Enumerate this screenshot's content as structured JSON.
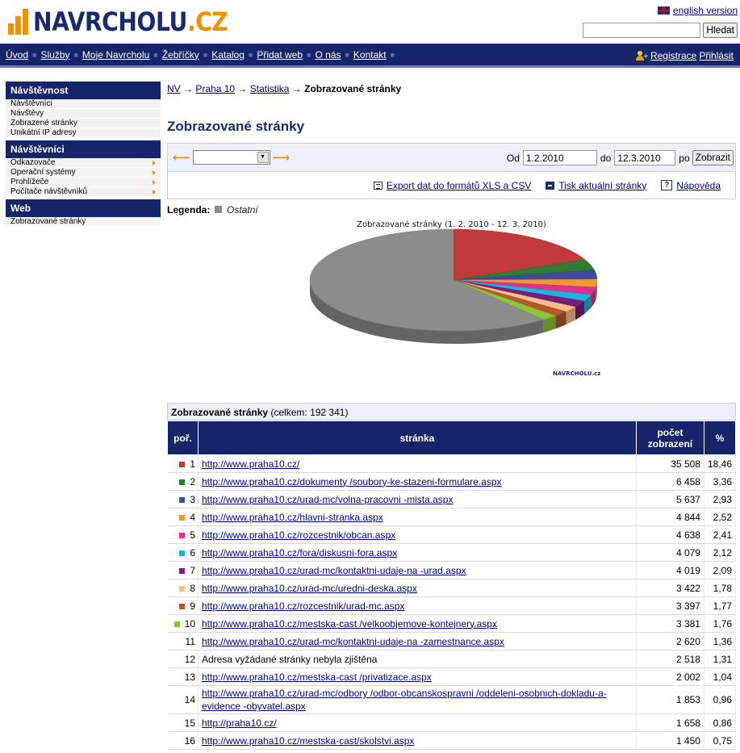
{
  "header": {
    "logo_main": "NAVRCHOLU",
    "logo_tld": ".CZ",
    "lang_link": "english version",
    "search_placeholder": "",
    "search_button": "Hledat"
  },
  "nav": {
    "items": [
      "Úvod",
      "Služby",
      "Moje Navrcholu",
      "Žebříčky",
      "Katalog",
      "Přidat web",
      "O nás",
      "Kontakt"
    ],
    "register": "Registrace",
    "login": "Přihlásit"
  },
  "sidebar": {
    "sections": [
      {
        "title": "Návštěvnost",
        "items": [
          {
            "label": "Návštěvníci",
            "arrow": false
          },
          {
            "label": "Návštěvy",
            "arrow": false
          },
          {
            "label": "Zobrazené stránky",
            "arrow": false
          },
          {
            "label": "Unikátní IP adresy",
            "arrow": false
          }
        ]
      },
      {
        "title": "Návštěvníci",
        "items": [
          {
            "label": "Odkazovače",
            "arrow": true
          },
          {
            "label": "Operační systémy",
            "arrow": true
          },
          {
            "label": "Prohlížeče",
            "arrow": true
          },
          {
            "label": "Počítače návštěvníků",
            "arrow": true
          }
        ]
      },
      {
        "title": "Web",
        "items": [
          {
            "label": "Zobrazované stránky",
            "arrow": false
          }
        ]
      }
    ]
  },
  "breadcrumb": {
    "links": [
      "NV",
      "Praha 10",
      "Statistika"
    ],
    "separator": "→",
    "current": "Zobrazované stránky"
  },
  "page_title": "Zobrazované stránky",
  "filter": {
    "select_value": "",
    "from_label": "Od",
    "from_value": "1.2.2010",
    "to_label": "do",
    "to_value": "12.3.2010",
    "po_label": "po",
    "submit": "Zobrazit"
  },
  "tools": {
    "export": "Export dat do formátů XLS a CSV",
    "print": "Tisk aktuální stránky",
    "help": "Nápověda"
  },
  "legend": {
    "label": "Legenda:",
    "item": "Ostatní"
  },
  "chart_data": {
    "type": "pie",
    "title": "Zobrazované stránky (1. 2. 2010 - 12. 3. 2010)",
    "brand": "NAVRCHOLU.cz",
    "slices": [
      {
        "label": "1",
        "value": 18.46,
        "color": "#c0393b"
      },
      {
        "label": "2",
        "value": 3.36,
        "color": "#2f7d32"
      },
      {
        "label": "3",
        "value": 2.93,
        "color": "#3d4a9e"
      },
      {
        "label": "4",
        "value": 2.52,
        "color": "#f0963a"
      },
      {
        "label": "5",
        "value": 2.41,
        "color": "#e0318a"
      },
      {
        "label": "6",
        "value": 2.12,
        "color": "#21b3e0"
      },
      {
        "label": "7",
        "value": 2.09,
        "color": "#7d1a7d"
      },
      {
        "label": "8",
        "value": 1.78,
        "color": "#f7c08a"
      },
      {
        "label": "9",
        "value": 1.77,
        "color": "#b5572a"
      },
      {
        "label": "10",
        "value": 1.76,
        "color": "#8cc43c"
      },
      {
        "label": "Ostatní",
        "value": 60.8,
        "color": "#8c8c8c"
      }
    ]
  },
  "table": {
    "title": "Zobrazované stránky",
    "total": "(celkem: 192 341)",
    "headers": {
      "rank": "poř.",
      "page": "stránka",
      "count_1": "počet",
      "count_2": "zobrazení",
      "pct": "%"
    },
    "rows": [
      {
        "rank": "1",
        "color": "#c0393b",
        "page": "http://www.praha10.cz/",
        "link": true,
        "count": "35 508",
        "pct": "18,46"
      },
      {
        "rank": "2",
        "color": "#2f7d32",
        "page": "http://www.praha10.cz/dokumenty /soubory-ke-stazeni-formulare.aspx",
        "link": true,
        "count": "6 458",
        "pct": "3,36"
      },
      {
        "rank": "3",
        "color": "#3d4a9e",
        "page": "http://www.praha10.cz/urad-mc/volna-pracovni -mista.aspx",
        "link": true,
        "count": "5 637",
        "pct": "2,93"
      },
      {
        "rank": "4",
        "color": "#f0963a",
        "page": "http://www.praha10.cz/hlavni-stranka.aspx",
        "link": true,
        "count": "4 844",
        "pct": "2,52"
      },
      {
        "rank": "5",
        "color": "#e0318a",
        "page": "http://www.praha10.cz/rozcestnik/obcan.aspx",
        "link": true,
        "count": "4 638",
        "pct": "2,41"
      },
      {
        "rank": "6",
        "color": "#21b3e0",
        "page": "http://www.praha10.cz/fora/diskusni-fora.aspx",
        "link": true,
        "count": "4 079",
        "pct": "2,12"
      },
      {
        "rank": "7",
        "color": "#7d1a7d",
        "page": "http://www.praha10.cz/urad-mc/kontaktni-udaje-na -urad.aspx",
        "link": true,
        "count": "4 019",
        "pct": "2,09"
      },
      {
        "rank": "8",
        "color": "#f7c08a",
        "page": "http://www.praha10.cz/urad-mc/uredni-deska.aspx",
        "link": true,
        "count": "3 422",
        "pct": "1,78"
      },
      {
        "rank": "9",
        "color": "#b5572a",
        "page": "http://www.praha10.cz/rozcestnik/urad-mc.aspx",
        "link": true,
        "count": "3 397",
        "pct": "1,77"
      },
      {
        "rank": "10",
        "color": "#8cc43c",
        "page": "http://www.praha10.cz/mestska-cast /velkoobjemove-kontejnery.aspx",
        "link": true,
        "count": "3 381",
        "pct": "1,76"
      },
      {
        "rank": "11",
        "color": "",
        "page": "http://www.praha10.cz/urad-mc/kontaktni-udaje-na -zamestnance.aspx",
        "link": true,
        "count": "2 620",
        "pct": "1,36"
      },
      {
        "rank": "12",
        "color": "",
        "page": "Adresa vyžádané stránky nebyla zjištěna",
        "link": false,
        "count": "2 518",
        "pct": "1,31"
      },
      {
        "rank": "13",
        "color": "",
        "page": "http://www.praha10.cz/mestska-cast /privatizace.aspx",
        "link": true,
        "count": "2 002",
        "pct": "1,04"
      },
      {
        "rank": "14",
        "color": "",
        "page": "http://www.praha10.cz/urad-mc/odbory /odbor-obcanskospravni /oddeleni-osobnich-dokladu-a-evidence -obyvatel.aspx",
        "link": true,
        "count": "1 853",
        "pct": "0,96"
      },
      {
        "rank": "15",
        "color": "",
        "page": "http://praha10.cz/",
        "link": true,
        "count": "1 658",
        "pct": "0,86"
      },
      {
        "rank": "16",
        "color": "",
        "page": "http://www.praha10.cz/mestska-cast/skolstvi.aspx",
        "link": true,
        "count": "1 450",
        "pct": "0,75"
      }
    ]
  }
}
